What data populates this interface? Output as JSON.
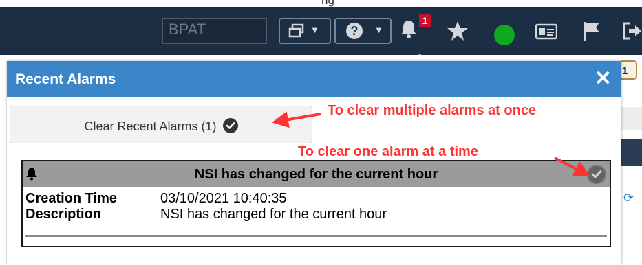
{
  "header_partial_text": "ng",
  "navbar": {
    "context_selector_value": "BPAT",
    "window_menu_icon": "windows-icon",
    "help_menu_icon": "question-circle-icon",
    "alarm_count": "1",
    "icons": [
      "bell-icon",
      "star-icon",
      "status-dot-icon",
      "id-card-icon",
      "flag-icon",
      "sign-out-icon"
    ],
    "status_color": "#10a823"
  },
  "right_panel": {
    "tab_text": "1"
  },
  "modal": {
    "title": "Recent Alarms",
    "close_glyph": "✕",
    "clear_button_label": "Clear Recent Alarms (1)",
    "header_color": "#3a86c8"
  },
  "alarm": {
    "title": "NSI has changed for the current hour",
    "fields": [
      {
        "label": "Creation Time",
        "value": "03/10/2021 10:40:35"
      },
      {
        "label": "Description",
        "value": "NSI has changed for the current hour"
      }
    ]
  },
  "annotations": {
    "multiple": "To clear multiple alarms at once",
    "single": "To clear one alarm at a time",
    "color": "#ff3333"
  }
}
